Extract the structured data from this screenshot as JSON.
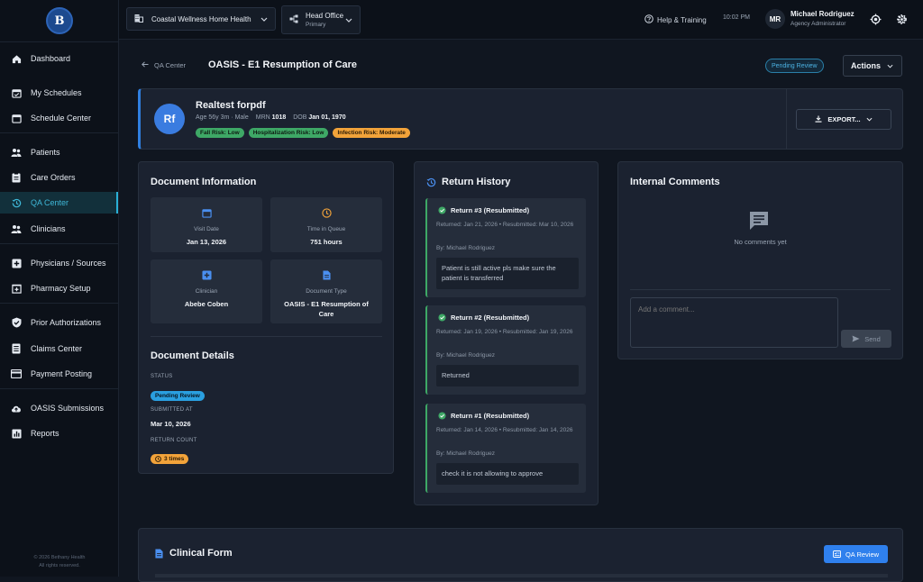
{
  "sidebar": {
    "logo_text": "B",
    "items": [
      {
        "label": "Dashboard",
        "icon": "home-icon"
      },
      {
        "label": "My Schedules",
        "icon": "calendar-check-icon"
      },
      {
        "label": "Schedule Center",
        "icon": "calendar-icon"
      },
      {
        "label": "Patients",
        "icon": "people-icon"
      },
      {
        "label": "Care Orders",
        "icon": "clipboard-icon"
      },
      {
        "label": "QA Center",
        "icon": "history-icon"
      },
      {
        "label": "Clinicians",
        "icon": "people-icon"
      },
      {
        "label": "Physicians / Sources",
        "icon": "plus-box-icon"
      },
      {
        "label": "Pharmacy Setup",
        "icon": "pharmacy-icon"
      },
      {
        "label": "Prior Authorizations",
        "icon": "shield-check-icon"
      },
      {
        "label": "Claims Center",
        "icon": "document-list-icon"
      },
      {
        "label": "Payment Posting",
        "icon": "credit-card-icon"
      },
      {
        "label": "OASIS Submissions",
        "icon": "cloud-upload-icon"
      },
      {
        "label": "Reports",
        "icon": "bar-chart-icon"
      }
    ],
    "copyright_line1": "© 2026 Bethany Health",
    "copyright_line2": "All rights reserved."
  },
  "topbar": {
    "org": "Coastal Wellness Home Health",
    "office": "Head Office",
    "office_sub": "Primary",
    "help": "Help & Training",
    "time": "10:02 PM",
    "avatar": "MR",
    "user_name": "Michael Rodriguez",
    "user_role": "Agency Administrator"
  },
  "header": {
    "back": "QA Center",
    "title": "OASIS - E1 Resumption of Care",
    "status": "Pending Review",
    "actions": "Actions"
  },
  "patient": {
    "initials": "Rf",
    "name": "Realtest forpdf",
    "age_sex": "Age 56y 3m · Male",
    "mrn_label": "MRN",
    "mrn": "1018",
    "dob_label": "DOB",
    "dob": "Jan 01, 1970",
    "badges": [
      "Fall Risk: Low",
      "Hospitalization Risk: Low",
      "Infection Risk: Moderate"
    ],
    "export": "EXPORT..."
  },
  "doc_info": {
    "title": "Document Information",
    "tiles": [
      {
        "label": "Visit Date",
        "value": "Jan 13, 2026",
        "icon": "calendar-icon"
      },
      {
        "label": "Time in Queue",
        "value": "751 hours",
        "icon": "clock-icon"
      },
      {
        "label": "Clinician",
        "value": "Abebe Coben",
        "icon": "medical-plus-icon"
      },
      {
        "label": "Document Type",
        "value": "OASIS - E1 Resumption of Care",
        "icon": "document-icon"
      }
    ],
    "details_title": "Document Details",
    "status_label": "STATUS",
    "status": "Pending Review",
    "submitted_label": "SUBMITTED AT",
    "submitted": "Mar 10, 2026",
    "return_label": "RETURN COUNT",
    "return_count": "3 times"
  },
  "return_history": {
    "title": "Return History",
    "items": [
      {
        "title": "Return #3 (Resubmitted)",
        "meta": "Returned: Jan 21, 2026 • Resubmitted: Mar 10, 2026",
        "by": "By: Michael Rodriguez",
        "note": "Patient is still active pls make sure the patient is transferred"
      },
      {
        "title": "Return #2 (Resubmitted)",
        "meta": "Returned: Jan 19, 2026 • Resubmitted: Jan 19, 2026",
        "by": "By: Michael Rodriguez",
        "note": "Returned"
      },
      {
        "title": "Return #1 (Resubmitted)",
        "meta": "Returned: Jan 14, 2026 • Resubmitted: Jan 14, 2026",
        "by": "By: Michael Rodriguez",
        "note": "check it is not allowing to approve"
      }
    ]
  },
  "comments": {
    "title": "Internal Comments",
    "empty": "No comments yet",
    "placeholder": "Add a comment...",
    "send": "Send"
  },
  "clinical": {
    "title": "Clinical Form",
    "qa_review": "QA Review"
  },
  "colors": {
    "accent": "#2ab0d6",
    "primary_button": "#2f80ed",
    "success": "#3ea866",
    "warning": "#f2a33a"
  }
}
